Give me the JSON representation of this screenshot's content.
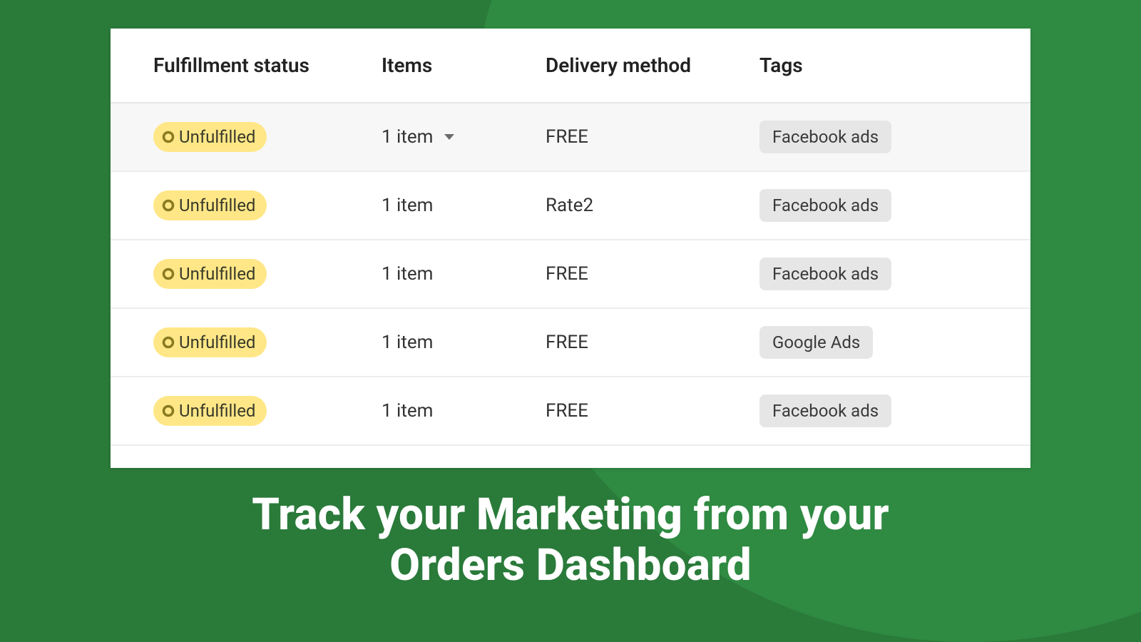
{
  "columns": {
    "fulfillment": "Fulfillment status",
    "items": "Items",
    "delivery": "Delivery method",
    "tags": "Tags"
  },
  "rows": [
    {
      "status": "Unfulfilled",
      "items": "1 item",
      "delivery": "FREE",
      "tag": "Facebook ads",
      "selected": true,
      "caret": true
    },
    {
      "status": "Unfulfilled",
      "items": "1 item",
      "delivery": "Rate2",
      "tag": "Facebook ads",
      "selected": false,
      "caret": false
    },
    {
      "status": "Unfulfilled",
      "items": "1 item",
      "delivery": "FREE",
      "tag": "Facebook ads",
      "selected": false,
      "caret": false
    },
    {
      "status": "Unfulfilled",
      "items": "1 item",
      "delivery": "FREE",
      "tag": "Google Ads",
      "selected": false,
      "caret": false
    },
    {
      "status": "Unfulfilled",
      "items": "1 item",
      "delivery": "FREE",
      "tag": "Facebook ads",
      "selected": false,
      "caret": false
    }
  ],
  "headline": {
    "prefix": "Track your ",
    "emph": "Marketing",
    "mid": " from your",
    "line2": "Orders Dashboard"
  }
}
